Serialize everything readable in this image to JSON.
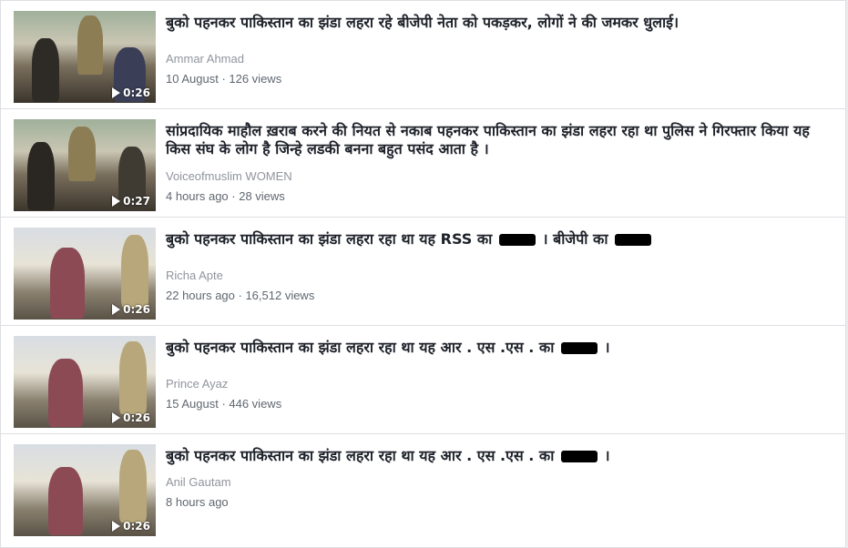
{
  "videos": [
    {
      "title": "बुको पहनकर पाकिस्तान का झंडा लहरा रहे बीजेपी नेता को पकड़कर, लोगों ने की जमकर धुलाई।",
      "author": "Ammar Ahmad",
      "meta": "10 August · 126 views",
      "duration": "0:26"
    },
    {
      "title": "सांप्रदायिक माहौल ख़राब करने की नियत से नकाब पहनकर पाकिस्तान का झंडा लहरा रहा था पुलिस ने गिरफ्तार किया यह किस संघ के लोग है जिन्हे लडकी बनना बहुत पसंद आता है ।",
      "author": "Voiceofmuslim WOMEN",
      "meta": "4 hours ago · 28 views",
      "duration": "0:27"
    },
    {
      "title_prefix": "बुको पहनकर पाकिस्तान का झंडा लहरा रहा था यह RSS का",
      "title_middle": "। बीजेपी का",
      "author": "Richa Apte",
      "meta": "22 hours ago · 16,512 views",
      "duration": "0:26"
    },
    {
      "title_prefix": "बुको पहनकर पाकिस्तान का झंडा लहरा रहा था यह आर . एस .एस . का",
      "title_suffix": "।",
      "author": "Prince Ayaz",
      "meta": "15 August · 446 views",
      "duration": "0:26"
    },
    {
      "title_prefix": "बुको पहनकर पाकिस्तान का झंडा लहरा रहा था यह आर . एस .एस . का",
      "title_suffix": "।",
      "author": "Anil Gautam",
      "meta": "8 hours ago",
      "duration": "0:26"
    }
  ]
}
